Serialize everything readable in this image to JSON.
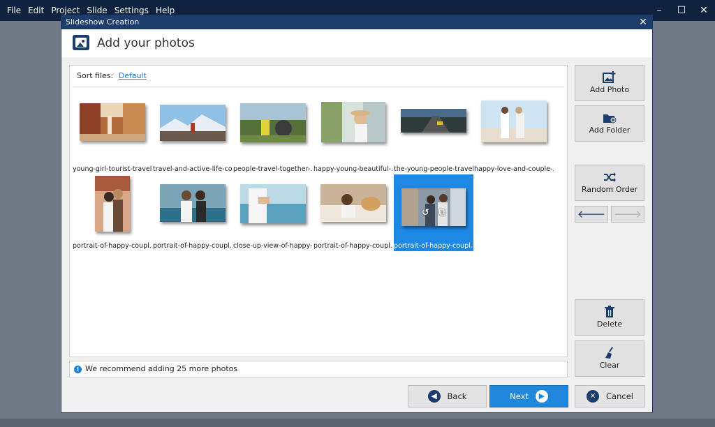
{
  "app_menu": [
    "File",
    "Edit",
    "Project",
    "Slide",
    "Settings",
    "Help"
  ],
  "window_controls": {
    "minimize": "–",
    "maximize": "☐",
    "close": "✕"
  },
  "dialog": {
    "title": "Slideshow Creation",
    "close": "✕",
    "heading": "Add your photos",
    "heading_icon": "photo-icon"
  },
  "sort": {
    "label": "Sort files:",
    "value": "Default"
  },
  "photos": [
    {
      "caption": "young-girl-tourist-travel...",
      "selected": false
    },
    {
      "caption": "travel-and-active-life-co...",
      "selected": false
    },
    {
      "caption": "people-travel-together-...",
      "selected": false
    },
    {
      "caption": "happy-young-beautiful-...",
      "selected": false
    },
    {
      "caption": "the-young-people-travel...",
      "selected": false
    },
    {
      "caption": "happy-love-and-couple-...",
      "selected": false
    },
    {
      "caption": "portrait-of-happy-coupl...",
      "selected": false
    },
    {
      "caption": "portrait-of-happy-coupl...",
      "selected": false
    },
    {
      "caption": "close-up-view-of-happy-...",
      "selected": false
    },
    {
      "caption": "portrait-of-happy-coupl...",
      "selected": false
    },
    {
      "caption": "portrait-of-happy-coupl...",
      "selected": true
    }
  ],
  "thumb_overlay": {
    "rotate": "↺",
    "crop": "⧉"
  },
  "info": "We recommend adding 25 more photos",
  "sidebar": {
    "add_photo": "Add Photo",
    "add_folder": "Add Folder",
    "random_order": "Random Order",
    "move_left": "🡐",
    "move_right": "🡒",
    "delete": "Delete",
    "clear": "Clear"
  },
  "footer": {
    "back": "Back",
    "next": "Next",
    "cancel": "Cancel"
  },
  "colors": {
    "accent": "#1f88dd",
    "title_bar": "#1c3c6b",
    "app_bar": "#0f2340"
  }
}
